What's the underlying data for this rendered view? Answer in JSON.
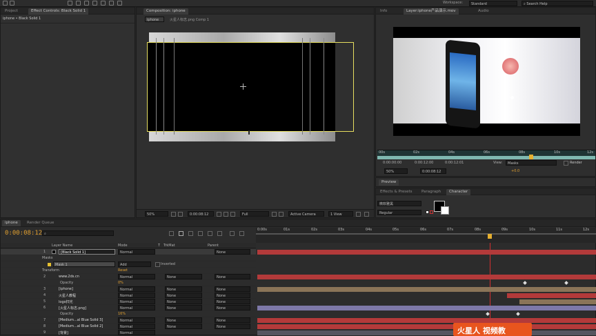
{
  "toolbar": {
    "workspace_label": "Workspace:",
    "workspace_value": "Standard",
    "search_placeholder": "Search Help"
  },
  "left_panel": {
    "tab_project": "Project",
    "tab_effect_controls": "Effect Controls: Black Solid 1",
    "subtitle": "iphone • Black Solid 1"
  },
  "comp_panel": {
    "tab": "Composition: iphone",
    "breadcrumb_1": "iphone",
    "breadcrumb_2": "火星人标志.png Comp 1",
    "zoom": "50%",
    "timecode": "0:00:08:12",
    "resolution": "Full",
    "camera": "Active Camera",
    "view": "1 View"
  },
  "layer_panel": {
    "tab_info": "Info",
    "tab_layer": "Layer:iphone产品演示.mov",
    "tab_audio": "Audio",
    "ruler": [
      "00s",
      "02s",
      "04s",
      "06s",
      "08s",
      "10s",
      "12s"
    ],
    "tc_in": "0:00:00:00",
    "tc_out": "0:00:12:00",
    "tc_dur": "0:00:12:01",
    "view_label": "View:",
    "view_value": "Masks",
    "render_label": "Render",
    "zoom": "50%",
    "timecode": "0:00:08:12",
    "offset": "+0.0"
  },
  "preview": {
    "tab": "Preview"
  },
  "character": {
    "tab_effects": "Effects & Presets",
    "tab_paragraph": "Paragraph",
    "tab_character": "Character",
    "font": "微软雅黑",
    "style": "Regular"
  },
  "timeline": {
    "tab_comp": "iphone",
    "tab_render": "Render Queue",
    "timecode": "0:00:08:12",
    "search_placeholder": "",
    "col_layer_name": "Layer Name",
    "col_mode": "Mode",
    "col_t": "T",
    "col_trkmat": "TrkMat",
    "col_parent": "Parent",
    "ruler": [
      "0:00s",
      "01s",
      "02s",
      "03s",
      "04s",
      "05s",
      "06s",
      "07s",
      "08s",
      "09s",
      "10s",
      "11s",
      "12s"
    ],
    "layers": [
      {
        "num": "1",
        "name": "[Black Solid 1]",
        "mode": "Normal",
        "trkmat": "",
        "parent": "None"
      },
      {
        "num": "",
        "name": "Masks",
        "mode": "",
        "trkmat": "",
        "parent": ""
      },
      {
        "num": "",
        "name": "Mask 1",
        "mode": "Add",
        "trkmat": "Inverted",
        "parent": ""
      },
      {
        "num": "",
        "name": "Transform",
        "mode": "Reset",
        "trkmat": "",
        "parent": ""
      },
      {
        "num": "2",
        "name": "www.2ds.cn",
        "mode": "Normal",
        "trkmat": "None",
        "parent": "None"
      },
      {
        "num": "",
        "name": "Opacity",
        "mode": "0%",
        "trkmat": "",
        "parent": ""
      },
      {
        "num": "3",
        "name": "[iphone]",
        "mode": "Normal",
        "trkmat": "None",
        "parent": "None"
      },
      {
        "num": "4",
        "name": "火星人教程",
        "mode": "Normal",
        "trkmat": "None",
        "parent": "None"
      },
      {
        "num": "5",
        "name": "logo扫光",
        "mode": "Normal",
        "trkmat": "None",
        "parent": "None"
      },
      {
        "num": "6",
        "name": "[火星人标志.png]",
        "mode": "Normal",
        "trkmat": "None",
        "parent": "None"
      },
      {
        "num": "",
        "name": "Opacity",
        "mode": "16%",
        "trkmat": "",
        "parent": ""
      },
      {
        "num": "7",
        "name": "[Medium...al Blue Solid 3]",
        "mode": "Normal",
        "trkmat": "None",
        "parent": "None"
      },
      {
        "num": "8",
        "name": "[Medium...al Blue Solid 2]",
        "mode": "Normal",
        "trkmat": "None",
        "parent": "None"
      },
      {
        "num": "9",
        "name": "[背景]",
        "mode": "Normal",
        "trkmat": "None",
        "parent": "None"
      }
    ]
  },
  "watermark": {
    "text": "火星人 视频教"
  }
}
